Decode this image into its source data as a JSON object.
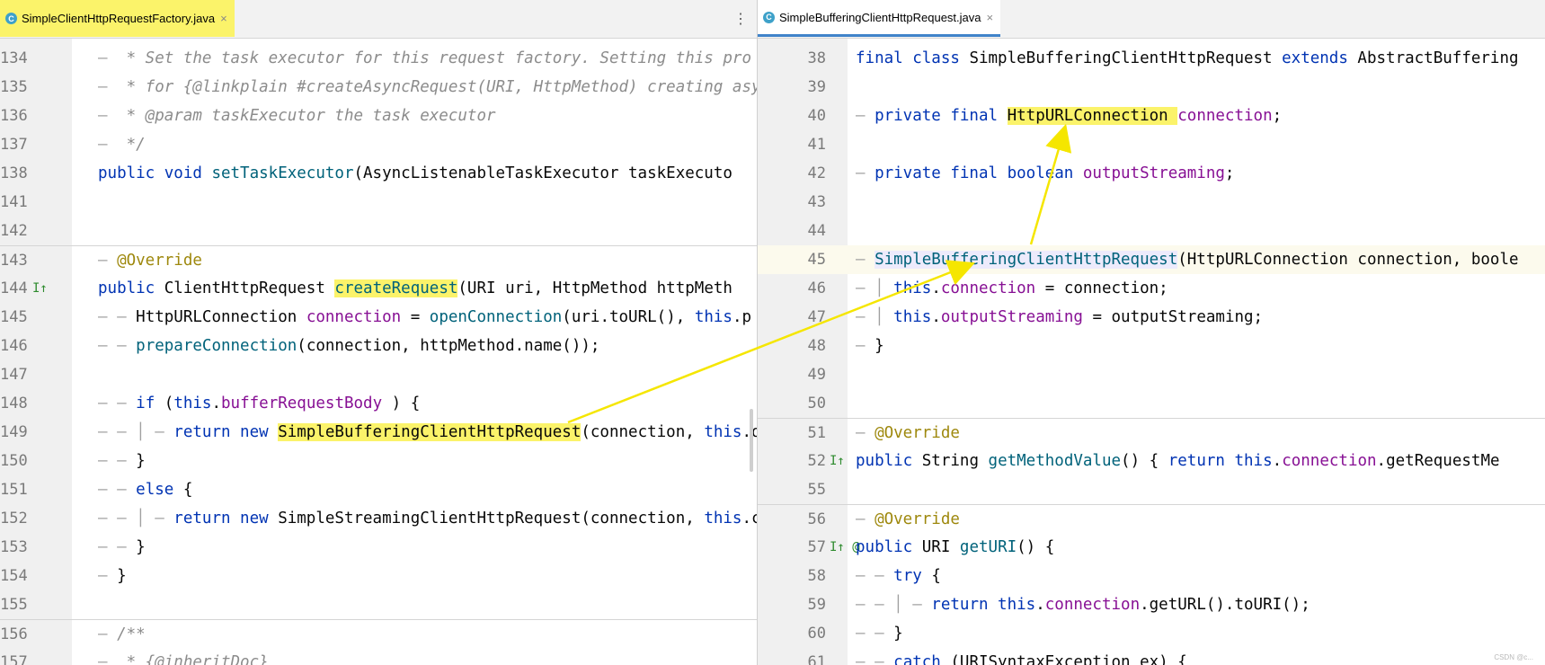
{
  "left": {
    "tab": {
      "label": "SimpleClientHttpRequestFactory.java",
      "icon": "C",
      "close": "×"
    },
    "more": "⋮",
    "lines": [
      {
        "n": "134",
        "segs": [
          [
            "guide",
            "— "
          ],
          [
            "cmt",
            " * Set the task executor for this request factory. Setting this pro"
          ]
        ]
      },
      {
        "n": "135",
        "segs": [
          [
            "guide",
            "— "
          ],
          [
            "cmt",
            " * for {@linkplain #createAsyncRequest(URI, HttpMethod) creating asy"
          ]
        ]
      },
      {
        "n": "136",
        "segs": [
          [
            "guide",
            "— "
          ],
          [
            "cmt",
            " * @param taskExecutor the task executor"
          ]
        ]
      },
      {
        "n": "137",
        "segs": [
          [
            "guide",
            "— "
          ],
          [
            "cmt",
            " */"
          ]
        ]
      },
      {
        "n": "138",
        "segs": [
          [
            "kw",
            "public void "
          ],
          [
            "fn",
            "setTaskExecutor"
          ],
          [
            "",
            "(AsyncListenableTaskExecutor taskExecuto"
          ]
        ]
      },
      {
        "n": "141",
        "segs": []
      },
      {
        "n": "142",
        "segs": []
      },
      {
        "n": "143",
        "sep": true,
        "segs": [
          [
            "guide",
            "— "
          ],
          [
            "ann",
            "@Override"
          ]
        ]
      },
      {
        "n": "144",
        "segs": [
          [
            "kw",
            "public "
          ],
          [
            "",
            "ClientHttpRequest "
          ],
          [
            "hl fn",
            "createRequest"
          ],
          [
            "",
            "(URI uri, HttpMethod httpMeth"
          ]
        ]
      },
      {
        "n": "145",
        "segs": [
          [
            "guide",
            "— — "
          ],
          [
            "",
            "HttpURLConnection "
          ],
          [
            "fld",
            "connection"
          ],
          [
            "",
            " = "
          ],
          [
            "fn",
            "openConnection"
          ],
          [
            "",
            "(uri.toURL(), "
          ],
          [
            "kw",
            "this"
          ],
          [
            "",
            ".p"
          ]
        ]
      },
      {
        "n": "146",
        "segs": [
          [
            "guide",
            "— — "
          ],
          [
            "fn",
            "prepareConnection"
          ],
          [
            "",
            "(connection, httpMethod.name());"
          ]
        ]
      },
      {
        "n": "147",
        "segs": []
      },
      {
        "n": "148",
        "segs": [
          [
            "guide",
            "— — "
          ],
          [
            "kw",
            "if "
          ],
          [
            "",
            "("
          ],
          [
            "kw",
            "this"
          ],
          [
            "",
            "."
          ],
          [
            "fld",
            "bufferRequestBody"
          ],
          [
            "",
            " ) {"
          ]
        ]
      },
      {
        "n": "149",
        "segs": [
          [
            "guide",
            "— — │ — "
          ],
          [
            "kw",
            "return new "
          ],
          [
            "hl",
            "SimpleBufferingClientHttpRequest"
          ],
          [
            "",
            "(connection, "
          ],
          [
            "kw",
            "this"
          ],
          [
            "",
            ".ou"
          ]
        ]
      },
      {
        "n": "150",
        "segs": [
          [
            "guide",
            "— — "
          ],
          [
            "",
            "}"
          ]
        ]
      },
      {
        "n": "151",
        "segs": [
          [
            "guide",
            "— — "
          ],
          [
            "kw",
            "else "
          ],
          [
            "",
            "{"
          ]
        ]
      },
      {
        "n": "152",
        "segs": [
          [
            "guide",
            "— — │ — "
          ],
          [
            "kw",
            "return new "
          ],
          [
            "",
            "SimpleStreamingClientHttpRequest(connection, "
          ],
          [
            "kw",
            "this"
          ],
          [
            "",
            ".ch"
          ]
        ]
      },
      {
        "n": "153",
        "segs": [
          [
            "guide",
            "— — "
          ],
          [
            "",
            "}"
          ]
        ]
      },
      {
        "n": "154",
        "segs": [
          [
            "guide",
            "— "
          ],
          [
            "",
            "}"
          ]
        ]
      },
      {
        "n": "155",
        "segs": []
      },
      {
        "n": "156",
        "sep": true,
        "segs": [
          [
            "guide",
            "— "
          ],
          [
            "cmt",
            "/**"
          ]
        ]
      },
      {
        "n": "157",
        "segs": [
          [
            "guide",
            "— "
          ],
          [
            "cmt",
            " * {@inheritDoc}"
          ]
        ]
      }
    ]
  },
  "right": {
    "tab": {
      "label": "SimpleBufferingClientHttpRequest.java",
      "icon": "C",
      "close": "×"
    },
    "lines": [
      {
        "n": "38",
        "segs": [
          [
            "kw",
            "final class "
          ],
          [
            "",
            "SimpleBufferingClientHttpRequest "
          ],
          [
            "kw",
            "extends "
          ],
          [
            "",
            "AbstractBuffering"
          ]
        ]
      },
      {
        "n": "39",
        "segs": []
      },
      {
        "n": "40",
        "segs": [
          [
            "guide",
            "— "
          ],
          [
            "kw",
            "private final "
          ],
          [
            "hl",
            "HttpURLConnection "
          ],
          [
            "fld",
            "connection"
          ],
          [
            "",
            ";"
          ]
        ]
      },
      {
        "n": "41",
        "segs": []
      },
      {
        "n": "42",
        "segs": [
          [
            "guide",
            "— "
          ],
          [
            "kw",
            "private final boolean "
          ],
          [
            "fld",
            "outputStreaming"
          ],
          [
            "",
            ";"
          ]
        ]
      },
      {
        "n": "43",
        "segs": []
      },
      {
        "n": "44",
        "segs": []
      },
      {
        "n": "45",
        "current": true,
        "segs": [
          [
            "guide",
            "— "
          ],
          [
            "hl2 fn",
            "SimpleBufferingClientHttpRequest"
          ],
          [
            "",
            "(HttpURLConnection connection, boole"
          ]
        ]
      },
      {
        "n": "46",
        "segs": [
          [
            "guide",
            "— │ "
          ],
          [
            "kw",
            "this"
          ],
          [
            "",
            "."
          ],
          [
            "fld",
            "connection"
          ],
          [
            "",
            " = connection;"
          ]
        ]
      },
      {
        "n": "47",
        "segs": [
          [
            "guide",
            "— │ "
          ],
          [
            "kw",
            "this"
          ],
          [
            "",
            "."
          ],
          [
            "fld",
            "outputStreaming"
          ],
          [
            "",
            " = outputStreaming;"
          ]
        ]
      },
      {
        "n": "48",
        "segs": [
          [
            "guide",
            "— "
          ],
          [
            "",
            "}"
          ]
        ]
      },
      {
        "n": "49",
        "segs": []
      },
      {
        "n": "50",
        "segs": []
      },
      {
        "n": "51",
        "sep": true,
        "segs": [
          [
            "guide",
            "— "
          ],
          [
            "ann",
            "@Override"
          ]
        ]
      },
      {
        "n": "52",
        "segs": [
          [
            "kw",
            "public "
          ],
          [
            "",
            "String "
          ],
          [
            "fn",
            "getMethodValue"
          ],
          [
            "",
            "() { "
          ],
          [
            "kw",
            "return this"
          ],
          [
            "",
            "."
          ],
          [
            "fld",
            "connection"
          ],
          [
            "",
            ".getRequestMe"
          ]
        ]
      },
      {
        "n": "55",
        "segs": []
      },
      {
        "n": "56",
        "sep": true,
        "segs": [
          [
            "guide",
            "— "
          ],
          [
            "ann",
            "@Override"
          ]
        ]
      },
      {
        "n": "57",
        "segs": [
          [
            "kw",
            "public "
          ],
          [
            "",
            "URI "
          ],
          [
            "fn",
            "getURI"
          ],
          [
            "",
            "() {"
          ]
        ]
      },
      {
        "n": "58",
        "segs": [
          [
            "guide",
            "— — "
          ],
          [
            "kw",
            "try "
          ],
          [
            "",
            "{"
          ]
        ]
      },
      {
        "n": "59",
        "segs": [
          [
            "guide",
            "— — │ — "
          ],
          [
            "kw",
            "return this"
          ],
          [
            "",
            "."
          ],
          [
            "fld",
            "connection"
          ],
          [
            "",
            ".getURL().toURI();"
          ]
        ]
      },
      {
        "n": "60",
        "segs": [
          [
            "guide",
            "— — "
          ],
          [
            "",
            "}"
          ]
        ]
      },
      {
        "n": "61",
        "segs": [
          [
            "guide",
            "— — "
          ],
          [
            "kw",
            "catch "
          ],
          [
            "",
            "(URISyntaxException ex) {"
          ]
        ]
      }
    ],
    "watermark": "CSDN @c..."
  },
  "gutter_icons": {
    "left_144": "I↑",
    "right_52": "I↑",
    "right_57": "I↑ @"
  }
}
